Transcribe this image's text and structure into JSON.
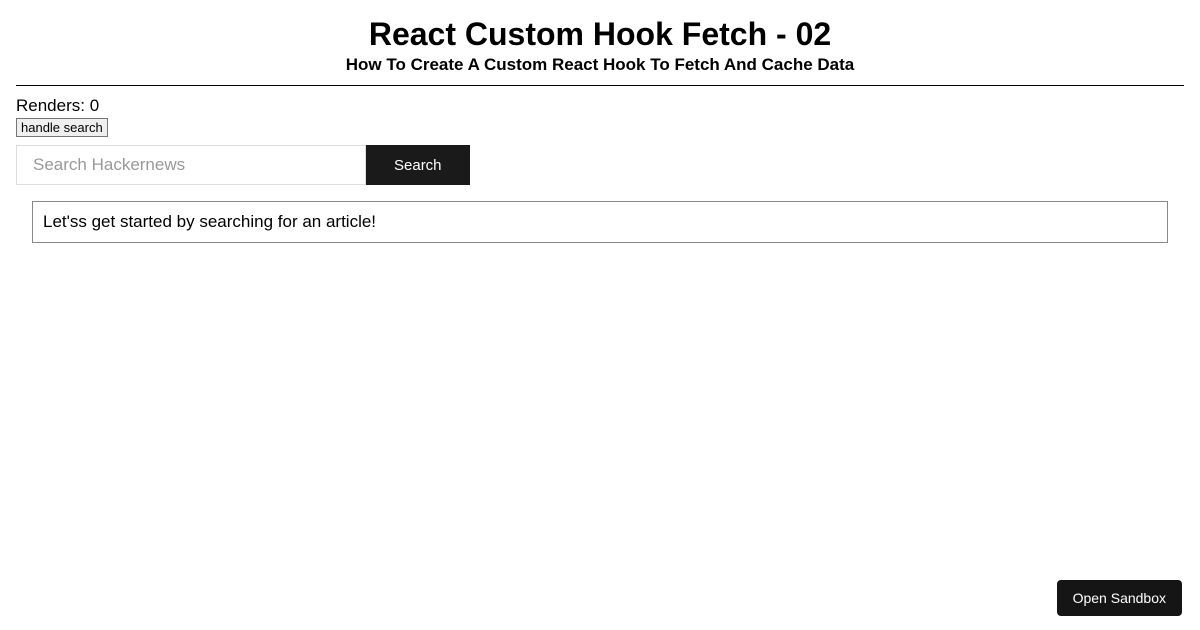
{
  "header": {
    "title": "React Custom Hook Fetch - 02",
    "subtitle": "How To Create A Custom React Hook To Fetch And Cache Data"
  },
  "content": {
    "renders_label": "Renders: 0",
    "handle_search_label": "handle search",
    "search_placeholder": "Search Hackernews",
    "search_button_label": "Search",
    "message": "Let'ss get started by searching for an article!"
  },
  "footer": {
    "open_sandbox_label": "Open Sandbox"
  }
}
